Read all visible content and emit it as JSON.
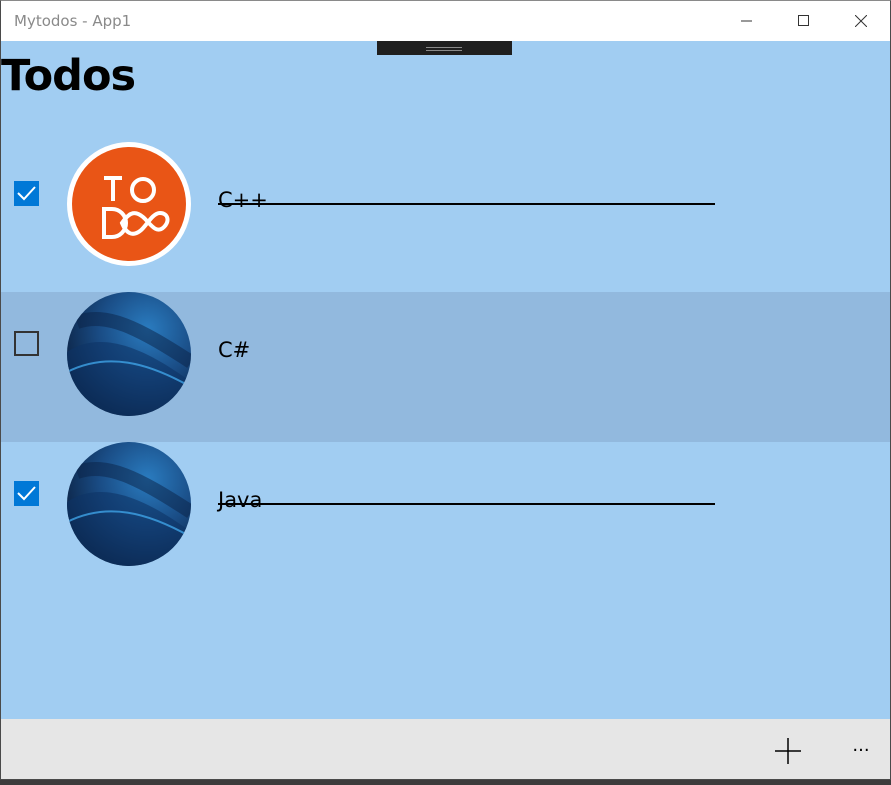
{
  "window": {
    "title": "Mytodos - App1"
  },
  "page": {
    "title": "Todos"
  },
  "todos": [
    {
      "label": "C++",
      "done": true,
      "avatar": "todo-logo",
      "selected": false
    },
    {
      "label": "C#",
      "done": false,
      "avatar": "blue-abstract",
      "selected": true
    },
    {
      "label": "Java",
      "done": true,
      "avatar": "blue-abstract",
      "selected": false
    }
  ],
  "appbar": {
    "add_icon": "add-icon",
    "more_label": "···"
  },
  "colors": {
    "background": "#a1cdf2",
    "selected_row": "#92b9de",
    "checkbox_checked": "#0078d7",
    "appbar": "#e6e6e6",
    "todo_logo": "#e95516"
  }
}
